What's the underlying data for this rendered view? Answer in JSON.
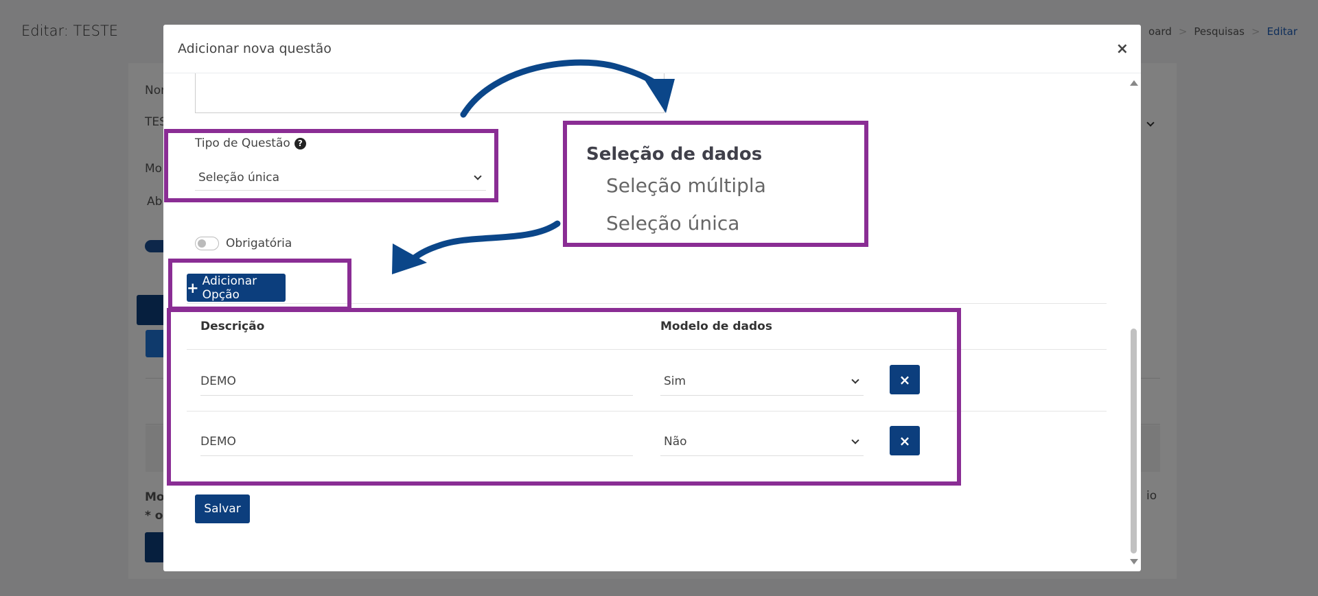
{
  "background": {
    "page_title": "Editar: TESTE",
    "breadcrumb": [
      "oard",
      "Pesquisas",
      "Editar"
    ],
    "labels": {
      "nome_fragment": "Nor",
      "nome_value_fragment": "TES",
      "model_fragment": "Mo",
      "model_value_fragment": "Ab",
      "bottom_fragment_1": "Mo",
      "bottom_fragment_2": "* ob",
      "right_fragment": "io"
    }
  },
  "modal": {
    "title": "Adicionar nova questão",
    "close_label": "×",
    "question_type": {
      "label": "Tipo de Questão",
      "help_icon": "?",
      "selected": "Seleção única"
    },
    "required_toggle": {
      "label": "Obrigatória",
      "checked": false
    },
    "add_option_button": "Adicionar Opção",
    "table": {
      "headers": [
        "Descrição",
        "Modelo de dados"
      ],
      "rows": [
        {
          "description": "DEMO",
          "data_model": "Sim"
        },
        {
          "description": "DEMO",
          "data_model": "Não"
        }
      ],
      "delete_label": "×"
    },
    "save_button": "Salvar"
  },
  "callout": {
    "title": "Seleção de dados",
    "options": [
      "Seleção múltipla",
      "Seleção única"
    ]
  },
  "colors": {
    "primary": "#0c3e7d",
    "highlight": "#8a2d94",
    "arrow": "#0b4689"
  }
}
